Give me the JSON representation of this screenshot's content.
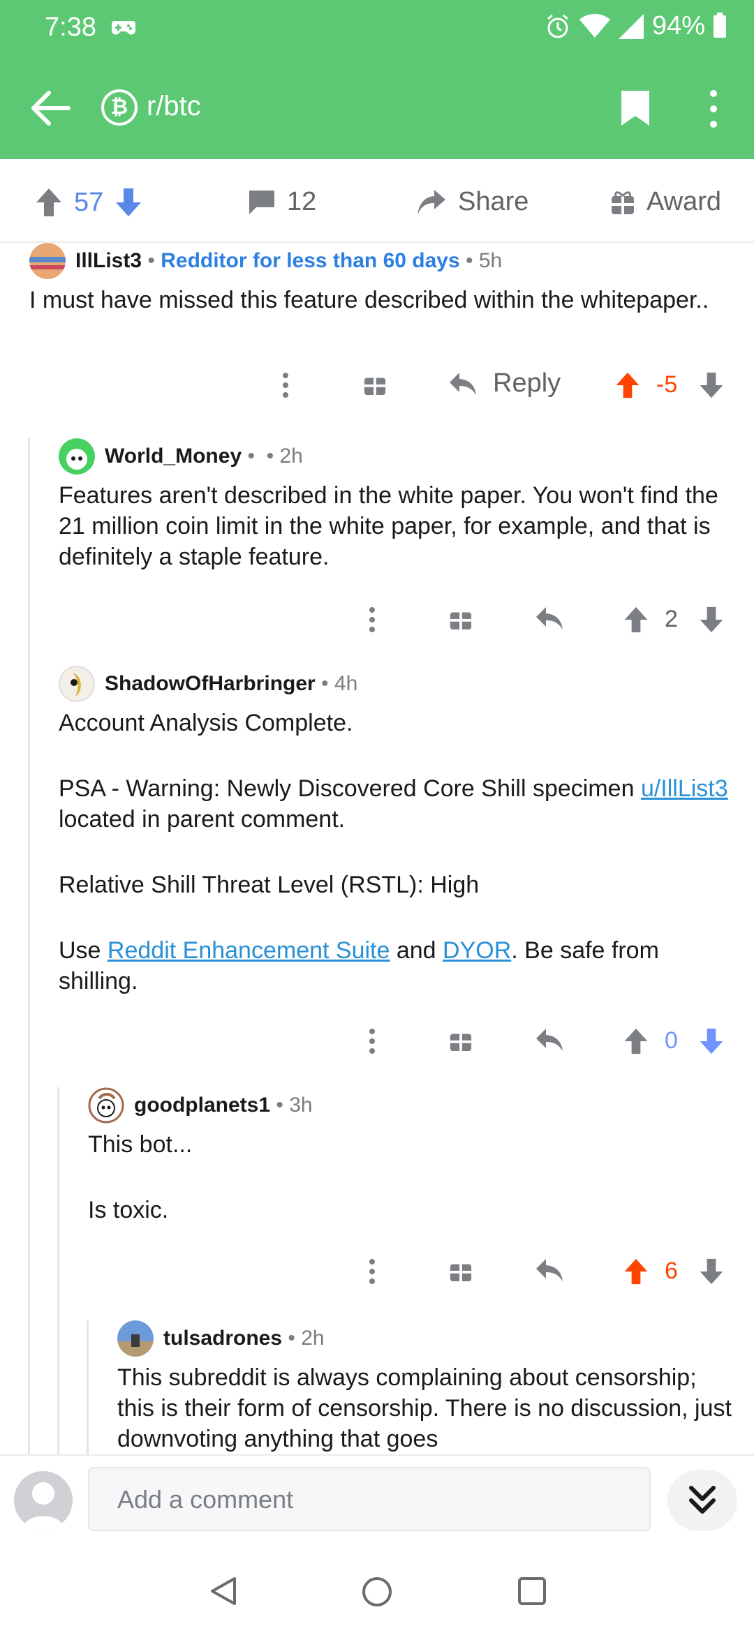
{
  "status_bar": {
    "time": "7:38",
    "battery": "94%"
  },
  "header": {
    "subreddit": "r/btc",
    "sub_icon_letter": "₿",
    "accent": "#5cc874"
  },
  "post_actions": {
    "upvotes": "57",
    "comments": "12",
    "share_label": "Share",
    "award_label": "Award"
  },
  "comments": [
    {
      "author": "IllList3",
      "flair": "Redditor for less than 60 days",
      "age": "5h",
      "body": [
        "I must have missed this feature described within the whitepaper.."
      ],
      "reply_label": "Reply",
      "score": "-5"
    },
    {
      "author": "World_Money",
      "age": "2h",
      "body": [
        "Features aren't described in the white paper. You won't find the 21 million coin limit in the white paper, for example, and that is definitely a staple feature."
      ],
      "score": "2"
    },
    {
      "author": "ShadowOfHarbringer",
      "age": "4h",
      "body_p1": "Account Analysis Complete.",
      "body_p2_pre": "PSA - Warning: Newly Discovered Core Shill specimen ",
      "body_p2_link": "u/IllList3",
      "body_p2_post": " located in parent comment.",
      "body_p3": "Relative Shill Threat Level (RSTL): High",
      "body_p4_pre": "Use ",
      "body_p4_link1": "Reddit Enhancement Suite",
      "body_p4_mid": " and ",
      "body_p4_link2": "DYOR",
      "body_p4_post": ". Be safe from shilling.",
      "score": "0"
    },
    {
      "author": "goodplanets1",
      "age": "3h",
      "body_p1": "This bot...",
      "body_p2": "Is toxic.",
      "score": "6"
    },
    {
      "author": "tulsadrones",
      "age": "2h",
      "body": [
        "This subreddit is always complaining about censorship; this is their form of censorship. There is no discussion, just downvoting anything that goes"
      ]
    }
  ],
  "composer": {
    "placeholder": "Add a comment"
  },
  "colors": {
    "upvote": "#ff4500",
    "downvote": "#7193ff",
    "link": "#2990d6",
    "flair": "#2c7fe3"
  }
}
